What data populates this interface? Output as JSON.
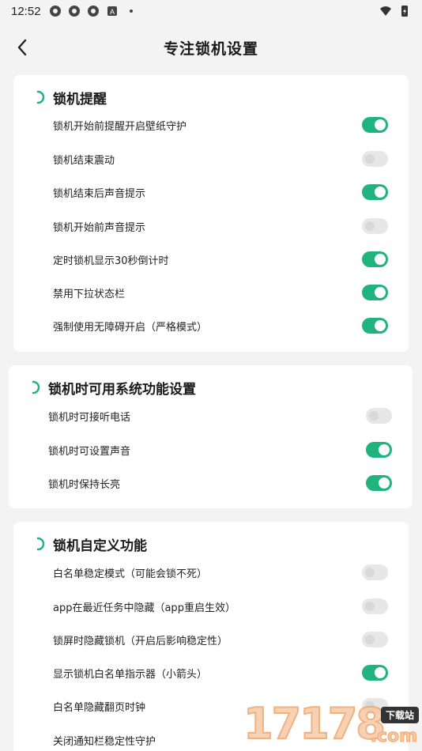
{
  "status_bar": {
    "time": "12:52",
    "left_icons": [
      "app-icon",
      "app-icon",
      "app-icon",
      "a-icon",
      "dot-icon"
    ],
    "right_icons": [
      "wifi-icon",
      "battery-icon"
    ]
  },
  "header": {
    "title": "专注锁机设置",
    "back_icon": "chevron-left-icon"
  },
  "colors": {
    "accent": "#1fb37e",
    "toggle_off": "#e7e7e7",
    "background": "#f3f3f3"
  },
  "sections": [
    {
      "title": "锁机提醒",
      "items": [
        {
          "label": "锁机开始前提醒开启壁纸守护",
          "on": true
        },
        {
          "label": "锁机结束震动",
          "on": false
        },
        {
          "label": "锁机结束后声音提示",
          "on": true
        },
        {
          "label": "锁机开始前声音提示",
          "on": false
        },
        {
          "label": "定时锁机显示30秒倒计时",
          "on": true
        },
        {
          "label": "禁用下拉状态栏",
          "on": true
        },
        {
          "label": "强制使用无障碍开启（严格模式）",
          "on": true
        }
      ]
    },
    {
      "title": "锁机时可用系统功能设置",
      "items": [
        {
          "label": "锁机时可接听电话",
          "on": false
        },
        {
          "label": "锁机时可设置声音",
          "on": true
        },
        {
          "label": "锁机时保持长亮",
          "on": true
        }
      ]
    },
    {
      "title": "锁机自定义功能",
      "items": [
        {
          "label": "白名单稳定模式（可能会锁不死）",
          "on": false
        },
        {
          "label": "app在最近任务中隐藏（app重启生效）",
          "on": false
        },
        {
          "label": "锁屏时隐藏锁机（开启后影响稳定性）",
          "on": false
        },
        {
          "label": "显示锁机白名单指示器（小箭头）",
          "on": true
        },
        {
          "label": "白名单隐藏翻页时钟",
          "on": false
        },
        {
          "label": "关闭通知栏稳定性守护",
          "on": false
        }
      ]
    }
  ],
  "watermark": {
    "digits": "17178",
    "badge": "下载站",
    "suffix": ".com"
  }
}
